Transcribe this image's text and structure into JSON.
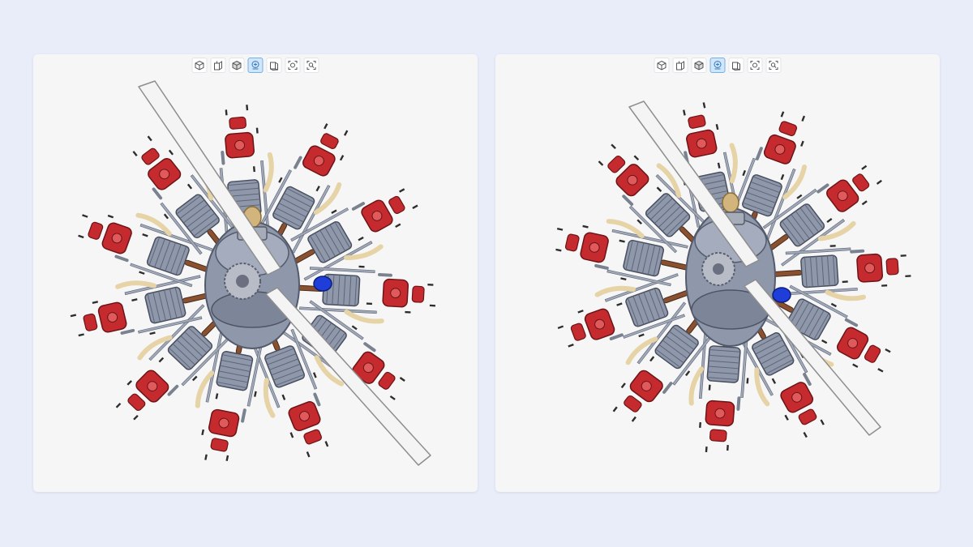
{
  "colors": {
    "background": "#e9edfa",
    "panel": "#f6f6f7",
    "toolbar_active": "#cfe6fb",
    "part_red": "#c42a2e",
    "part_steel": "#8f98ab",
    "part_tan": "#e6d3a6",
    "part_brown": "#8a5130",
    "part_blue": "#1f3dd8",
    "propeller": "#f4f4f4"
  },
  "panels": [
    {
      "id": "left",
      "view": "exploded-radial-engine-view-a",
      "toolbar": [
        {
          "icon": "cube-icon",
          "active": false
        },
        {
          "icon": "box-cut-icon",
          "active": false
        },
        {
          "icon": "solid-cube-icon",
          "active": false
        },
        {
          "icon": "explode-view-icon",
          "active": true
        },
        {
          "icon": "cube-outline-icon",
          "active": false
        },
        {
          "icon": "focus-icon",
          "active": false
        },
        {
          "icon": "zoom-fit-icon",
          "active": false
        }
      ]
    },
    {
      "id": "right",
      "view": "exploded-radial-engine-view-b",
      "toolbar": [
        {
          "icon": "cube-icon",
          "active": false
        },
        {
          "icon": "box-cut-icon",
          "active": false
        },
        {
          "icon": "solid-cube-icon",
          "active": false
        },
        {
          "icon": "explode-view-icon",
          "active": true
        },
        {
          "icon": "cube-outline-icon",
          "active": false
        },
        {
          "icon": "focus-icon",
          "active": false
        },
        {
          "icon": "zoom-fit-icon",
          "active": false
        }
      ]
    }
  ]
}
